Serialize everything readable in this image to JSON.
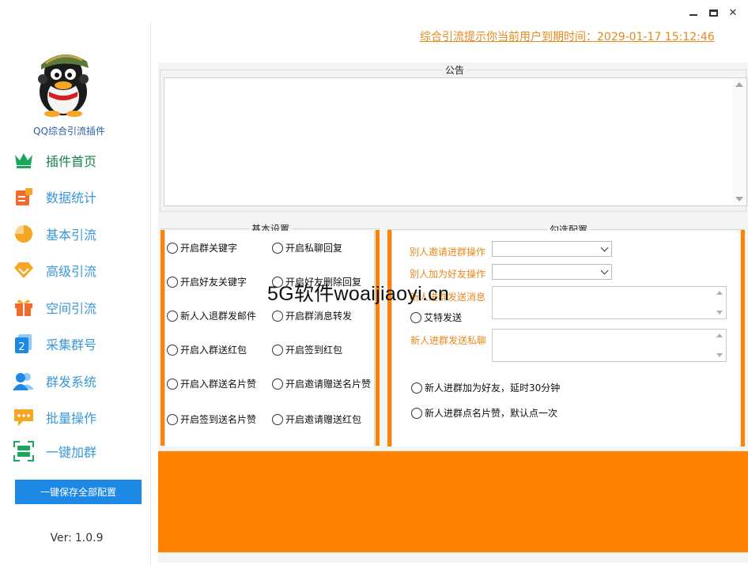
{
  "window": {
    "controls": [
      "minimize",
      "maximize",
      "close"
    ],
    "close_glyph": "✕"
  },
  "sidebar": {
    "app_name": "QQ综合引流插件",
    "items": [
      {
        "label": "插件首页",
        "icon": "crown-icon",
        "color": "#17a85a",
        "active": true
      },
      {
        "label": "数据统计",
        "icon": "document-chart-icon",
        "color": "#f36a2a"
      },
      {
        "label": "基本引流",
        "icon": "pie-chart-icon",
        "color": "#f5a623"
      },
      {
        "label": "高级引流",
        "icon": "diamond-icon",
        "color": "#f5a623"
      },
      {
        "label": "空间引流",
        "icon": "gift-icon",
        "color": "#f36a2a"
      },
      {
        "label": "采集群号",
        "icon": "number-two-icon",
        "color": "#1e88e5"
      },
      {
        "label": "群发系统",
        "icon": "users-icon",
        "color": "#1e88e5"
      },
      {
        "label": "批量操作",
        "icon": "chat-dots-icon",
        "color": "#f5a623"
      },
      {
        "label": "一键加群",
        "icon": "scan-frame-icon",
        "color": "#17a85a"
      }
    ],
    "save_button": "一键保存全部配置",
    "version_label": "Ver:",
    "version_value": "1.0.9"
  },
  "header": {
    "expire_text": "综合引流提示你当前用户到期时间：2029-01-17 15:12:46"
  },
  "notice": {
    "title": "公告",
    "content": ""
  },
  "basic_settings": {
    "title": "基本设置",
    "options": [
      "开启群关键字",
      "开启私聊回复",
      "开启好友关键字",
      "开启好友删除回复",
      "新人入退群发邮件",
      "开启群消息转发",
      "开启入群送红包",
      "开启签到红包",
      "开启入群送名片赞",
      "开启邀请赠送名片赞",
      "开启签到送名片赞",
      "开启邀请赠送红包"
    ]
  },
  "check_config": {
    "title": "勾选配置",
    "invite_label": "别人邀请进群操作",
    "invite_value": "",
    "friend_label": "别人加为好友操作",
    "friend_value": "",
    "newcomer_msg_label": "新人进群发送消息",
    "at_send_label": "艾特发送",
    "newcomer_pm_label": "新人进群发送私聊",
    "add_friend_option": "新人进群加为好友，延时30分钟",
    "like_option": "新人进群点名片赞，默认点一次"
  },
  "watermark": "5G软件woaijiaoyi.cn",
  "colors": {
    "accent_orange": "#ff8200",
    "text_orange": "#e7891c",
    "nav_blue": "#3a97d6",
    "nav_active_green": "#17824a",
    "button_blue": "#1e88e5"
  }
}
